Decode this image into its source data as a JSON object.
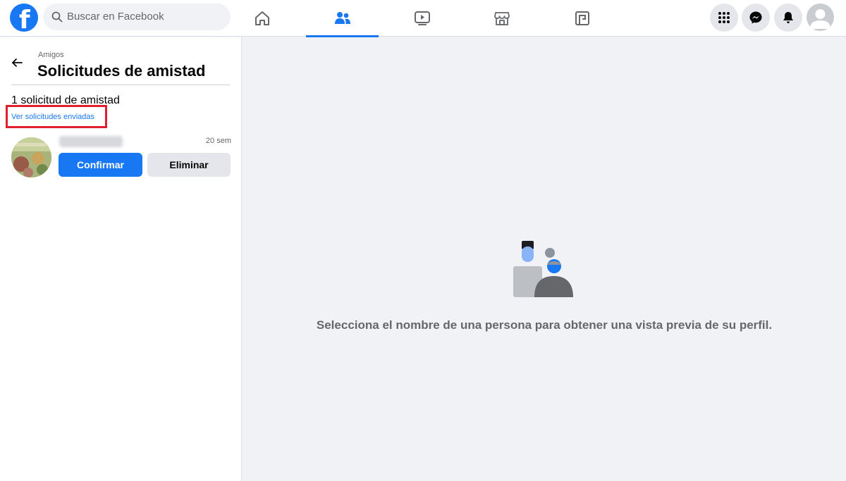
{
  "header": {
    "logo_letter": "f",
    "search_placeholder": "Buscar en Facebook",
    "nav_tabs": [
      {
        "icon": "home-icon",
        "active": false
      },
      {
        "icon": "friends-icon",
        "active": true
      },
      {
        "icon": "watch-icon",
        "active": false
      },
      {
        "icon": "marketplace-icon",
        "active": false
      },
      {
        "icon": "gaming-icon",
        "active": false
      }
    ],
    "right_buttons": [
      "menu-grid-icon",
      "messenger-icon",
      "notifications-icon"
    ],
    "accent_color": "#1877f2"
  },
  "sidebar": {
    "breadcrumb": "Amigos",
    "title": "Solicitudes de amistad",
    "request_count": "1 solicitud de amistad",
    "sent_link": "Ver solicitudes enviadas",
    "highlight_color": "#e0202e",
    "requests": [
      {
        "time": "20 sem",
        "confirm_label": "Confirmar",
        "delete_label": "Eliminar"
      }
    ]
  },
  "main": {
    "empty_message": "Selecciona el nombre de una persona para obtener una vista previa de su perfil."
  }
}
